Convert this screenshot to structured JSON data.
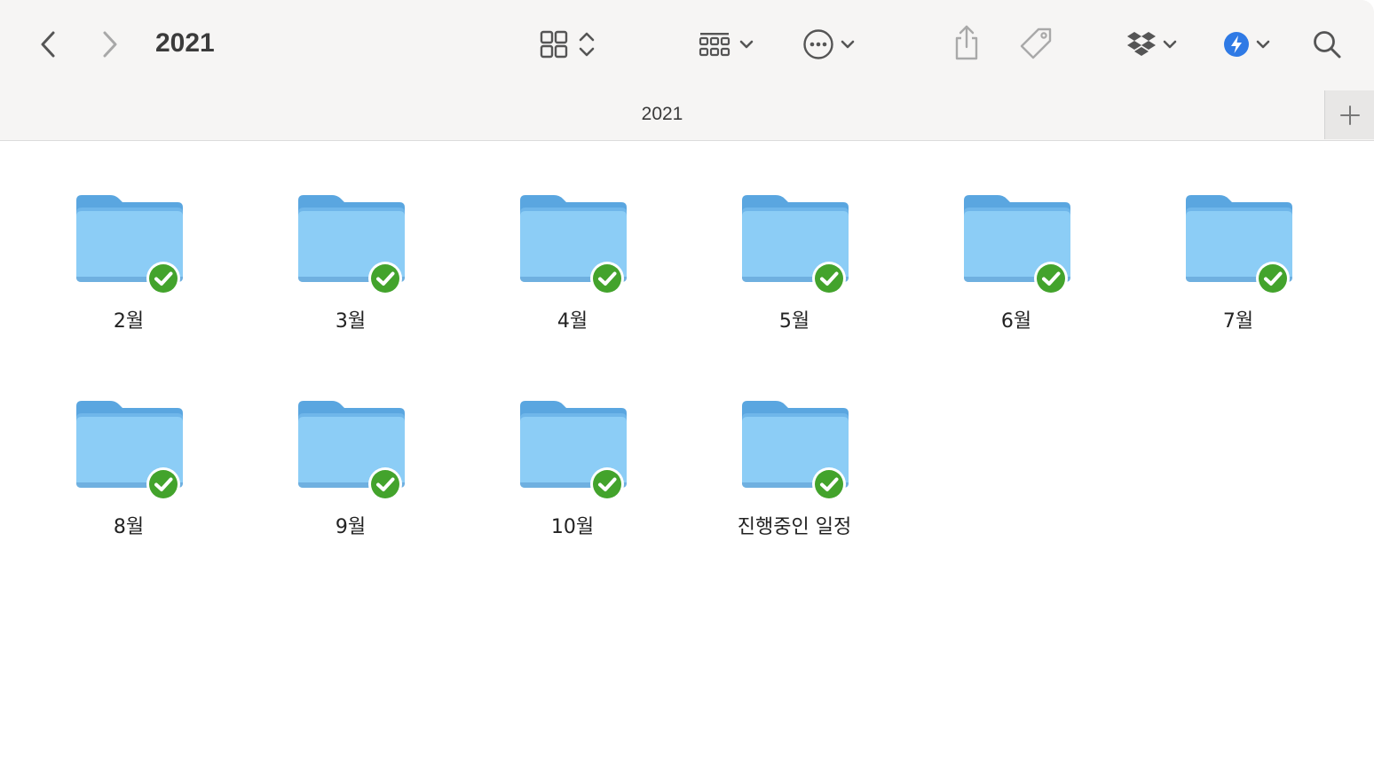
{
  "window": {
    "title": "2021",
    "tab_title": "2021"
  },
  "toolbar": {
    "back_icon": "chevron-left-icon",
    "forward_icon": "chevron-right-icon",
    "view_icon": "grid-view-icon",
    "group_icon": "group-by-icon",
    "action_icon": "ellipsis-circle-icon",
    "share_icon": "share-icon",
    "tag_icon": "tag-icon",
    "dropbox_icon": "dropbox-icon",
    "shortcut_icon": "bolt-circle-icon",
    "search_icon": "search-icon"
  },
  "colors": {
    "folder_light": "#8ccdf6",
    "folder_dark": "#5aa6e0",
    "badge_green": "#43a32c",
    "accent_blue": "#2f7ae5"
  },
  "folders": [
    {
      "name": "2월",
      "synced": true
    },
    {
      "name": "3월",
      "synced": true
    },
    {
      "name": "4월",
      "synced": true
    },
    {
      "name": "5월",
      "synced": true
    },
    {
      "name": "6월",
      "synced": true
    },
    {
      "name": "7월",
      "synced": true
    },
    {
      "name": "8월",
      "synced": true
    },
    {
      "name": "9월",
      "synced": true
    },
    {
      "name": "10월",
      "synced": true
    },
    {
      "name": "진행중인 일정",
      "synced": true
    }
  ]
}
